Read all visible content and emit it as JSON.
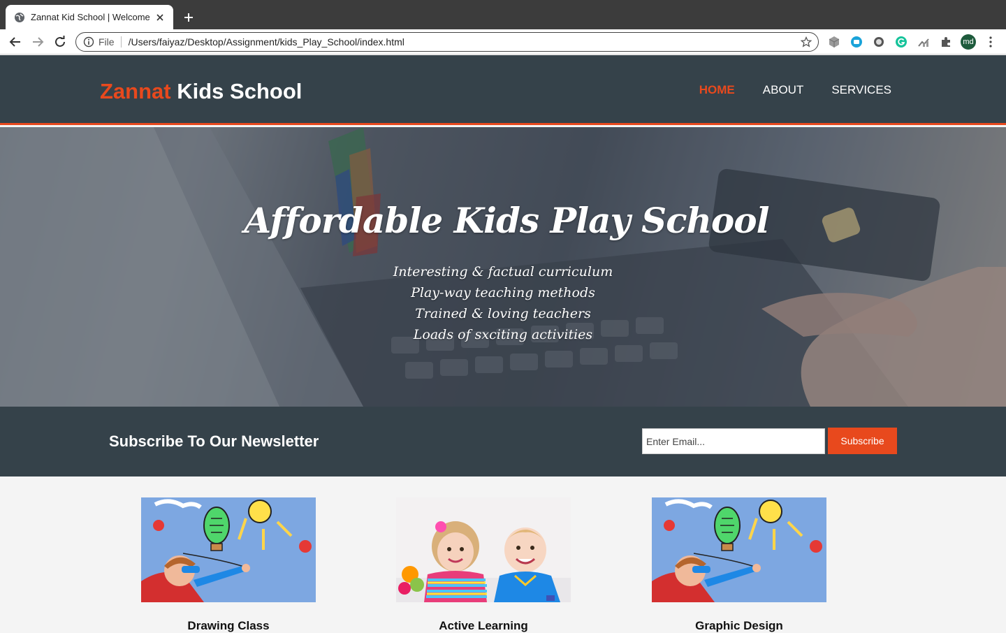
{
  "browser": {
    "tab_title": "Zannat Kid School | Welcome",
    "url_scheme_label": "File",
    "url": "/Users/faiyaz/Desktop/Assignment/kids_Play_School/index.html",
    "profile_initials": "md",
    "icons": [
      "globe-icon",
      "close-icon",
      "plus-icon",
      "back-arrow-icon",
      "forward-arrow-icon",
      "reload-icon",
      "info-icon",
      "star-icon",
      "cube-extension-icon",
      "record-extension-icon",
      "circle-extension-icon",
      "grammarly-extension-icon",
      "chart-extension-icon",
      "puzzle-icon",
      "kebab-menu-icon"
    ]
  },
  "site": {
    "logo_highlight": "Zannat",
    "logo_rest": " Kids School",
    "nav": [
      {
        "label": "Home",
        "current": true
      },
      {
        "label": "About",
        "current": false
      },
      {
        "label": "Services",
        "current": false
      }
    ],
    "accent_color": "#e8491d",
    "header_color": "#35424a"
  },
  "hero": {
    "title": "Affordable Kids Play School",
    "features": [
      "Interesting & factual curriculum",
      "Play-way teaching methods",
      "Trained & loving teachers",
      "Loads of sxciting activities"
    ]
  },
  "newsletter": {
    "heading": "Subscribe To Our Newsletter",
    "email_placeholder": "Enter Email...",
    "button_label": "Subscribe"
  },
  "boxes": [
    {
      "title": "Drawing Class",
      "image": "boy-superhero-drawing"
    },
    {
      "title": "Active Learning",
      "image": "smiling-children"
    },
    {
      "title": "Graphic Design",
      "image": "boy-superhero-drawing"
    }
  ]
}
